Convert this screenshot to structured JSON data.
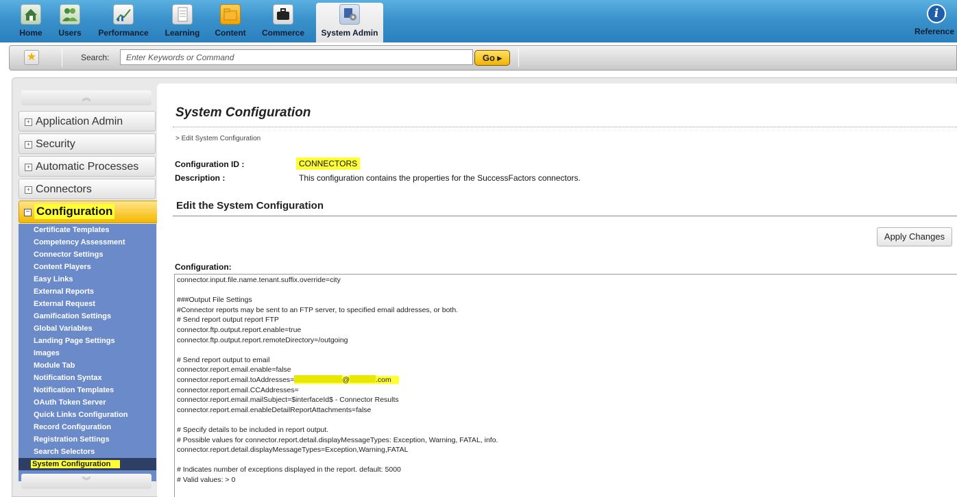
{
  "nav": {
    "items": [
      {
        "label": "Home",
        "icon": "home-icon"
      },
      {
        "label": "Users",
        "icon": "users-icon"
      },
      {
        "label": "Performance",
        "icon": "performance-icon"
      },
      {
        "label": "Learning",
        "icon": "learning-icon"
      },
      {
        "label": "Content",
        "icon": "content-icon"
      },
      {
        "label": "Commerce",
        "icon": "commerce-icon"
      },
      {
        "label": "System Admin",
        "icon": "system-admin-icon"
      }
    ],
    "active": "System Admin",
    "reference_label": "Reference"
  },
  "search": {
    "label": "Search:",
    "placeholder": "Enter Keywords or Command",
    "go_label": "Go ▸"
  },
  "sidebar": {
    "sections": [
      "Application Admin",
      "Security",
      "Automatic Processes",
      "Connectors",
      "Configuration"
    ],
    "expanded": "Configuration",
    "sub_items": [
      "Certificate Templates",
      "Competency Assessment",
      "Connector Settings",
      "Content Players",
      "Easy Links",
      "External Reports",
      "External Request",
      "Gamification Settings",
      "Global Variables",
      "Landing Page Settings",
      "Images",
      "Module Tab",
      "Notification Syntax",
      "Notification Templates",
      "OAuth Token Server",
      "Quick Links Configuration",
      "Record Configuration",
      "Registration Settings",
      "Search Selectors",
      "System Configuration"
    ],
    "selected": "System Configuration"
  },
  "main": {
    "title": "System Configuration",
    "breadcrumb": "> Edit System Configuration",
    "config_id_label": "Configuration ID :",
    "config_id_value": "CONNECTORS",
    "description_label": "Description :",
    "description_value": "This configuration contains the properties for the SuccessFactors connectors.",
    "section_heading": "Edit the System Configuration",
    "apply_label": "Apply Changes",
    "configuration_label": "Configuration:",
    "config_lines": [
      "connector.input.file.name.tenant.suffix.override=city",
      "",
      "###Output File Settings",
      "#Connector reports may be sent to an FTP server, to specified email addresses, or both.",
      "# Send report output report FTP",
      "connector.ftp.output.report.enable=true",
      "connector.ftp.output.report.remoteDirectory=/outgoing",
      "",
      "# Send report output to email",
      "connector.report.email.enable=false",
      "connector.report.email.toAddresses=@.com",
      "connector.report.email.CCAddresses=",
      "connector.report.email.mailSubject=$interfaceId$ - Connector Results",
      "connector.report.email.enableDetailReportAttachments=false",
      "",
      "# Specify details to be included in report output.",
      "# Possible values for connector.report.detail.displayMessageTypes: Exception, Warning, FATAL, info.",
      "connector.report.detail.displayMessageTypes=Exception,Warning,FATAL",
      "",
      "# Indicates number of exceptions displayed in the report. default: 5000",
      "# Valid values: > 0"
    ],
    "email_prefix": "connector.report.email.toAddresses=",
    "email_at": "@",
    "email_suffix": ".com"
  },
  "colors": {
    "nav_bg": "#3a92cb",
    "highlight": "#ffff33",
    "submenu_bg": "#6b8ac9",
    "selected_bg": "#2e3f66",
    "go_button": "#f1b400"
  }
}
